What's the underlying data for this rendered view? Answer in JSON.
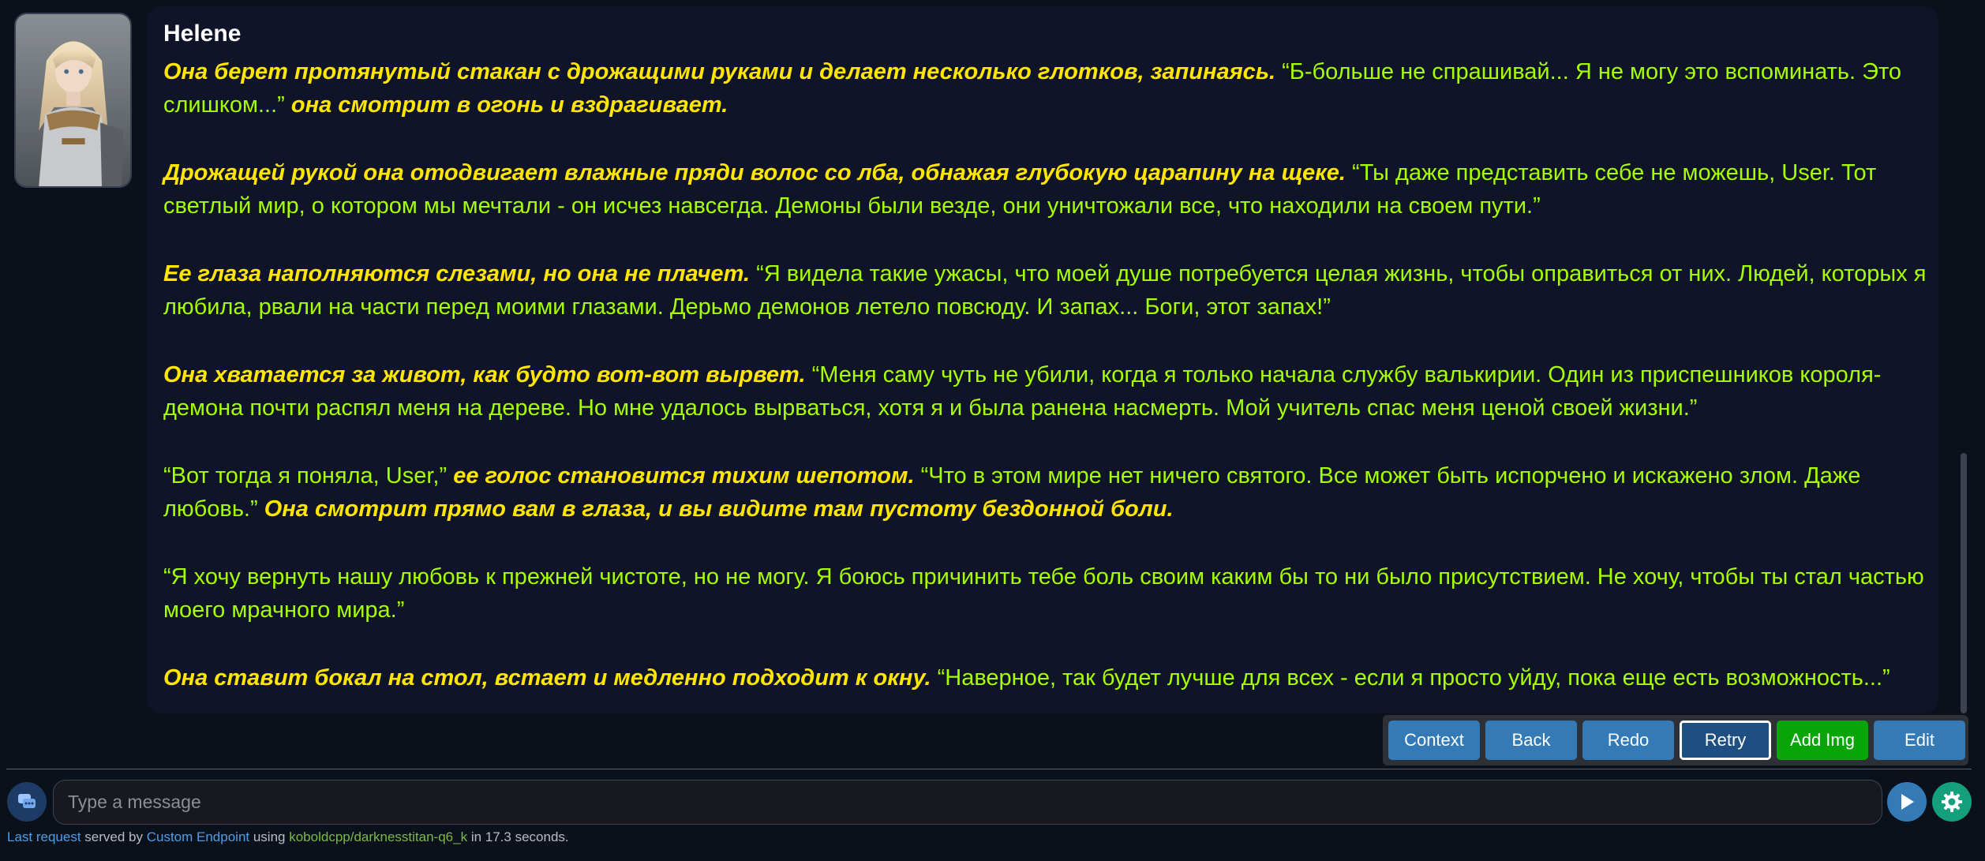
{
  "message": {
    "character_name": "Helene",
    "paragraphs": [
      [
        {
          "text": "Она берет протянутый стакан с дрожащими руками и делает несколько глотков, запинаясь.",
          "action": true
        },
        {
          "text": " “Б-больше не спрашивай... Я не могу это вспоминать. Это слишком...” ",
          "action": false
        },
        {
          "text": "она смотрит в огонь и вздрагивает.",
          "action": true
        }
      ],
      [
        {
          "text": "Дрожащей рукой она отодвигает влажные пряди волос со лба, обнажая глубокую царапину на щеке.",
          "action": true
        },
        {
          "text": " “Ты даже представить себе не можешь, User. Тот светлый мир, о котором мы мечтали - он исчез навсегда. Демоны были везде, они уничтожали все, что находили на своем пути.”",
          "action": false
        }
      ],
      [
        {
          "text": "Ее глаза наполняются слезами, но она не плачет.",
          "action": true
        },
        {
          "text": " “Я видела такие ужасы, что моей душе потребуется целая жизнь, чтобы оправиться от них. Людей, которых я любила, рвали на части перед моими глазами. Дерьмо демонов летело повсюду. И запах... Боги, этот запах!”",
          "action": false
        }
      ],
      [
        {
          "text": "Она хватается за живот, как будто вот-вот вырвет.",
          "action": true
        },
        {
          "text": " “Меня саму чуть не убили, когда я только начала службу валькирии. Один из приспешников короля-демона почти распял меня на дереве. Но мне удалось вырваться, хотя я и была ранена насмерть. Мой учитель спас меня ценой своей жизни.”",
          "action": false
        }
      ],
      [
        {
          "text": "“Вот тогда я поняла, User,” ",
          "action": false
        },
        {
          "text": "ее голос становится тихим шепотом.",
          "action": true
        },
        {
          "text": " “Что в этом мире нет ничего святого. Все может быть испорчено и искажено злом. Даже любовь.” ",
          "action": false
        },
        {
          "text": "Она смотрит прямо вам в глаза, и вы видите там пустоту бездонной боли.",
          "action": true
        }
      ],
      [
        {
          "text": "“Я хочу вернуть нашу любовь к прежней чистоте, но не могу. Я боюсь причинить тебе боль своим каким бы то ни было присутствием. Не хочу, чтобы ты стал частью моего мрачного мира.”",
          "action": false
        }
      ],
      [
        {
          "text": "Она ставит бокал на стол, встает и медленно подходит к окну.",
          "action": true
        },
        {
          "text": " “Наверное, так будет лучше для всех - если я просто уйду, пока еще есть возможность...”",
          "action": false
        }
      ]
    ]
  },
  "actions": {
    "context": "Context",
    "back": "Back",
    "redo": "Redo",
    "retry": "Retry",
    "add_img": "Add Img",
    "edit": "Edit"
  },
  "input": {
    "placeholder": "Type a message",
    "value": ""
  },
  "status": {
    "last_request": "Last request",
    "served_by": " served by ",
    "endpoint": "Custom Endpoint",
    "using": " using ",
    "model": "koboldcpp/darknesstitan-q6_k",
    "duration": " in 17.3 seconds."
  },
  "icons": {
    "chat": "chat-bubble-icon",
    "send": "play-send-icon",
    "settings": "gear-icon",
    "avatar": "character-portrait"
  },
  "colors": {
    "dialogue": "#a6ff00",
    "action": "#ffe600",
    "button": "#337ab7",
    "add_img_button": "#08a508",
    "settings_button": "#13a07a"
  }
}
